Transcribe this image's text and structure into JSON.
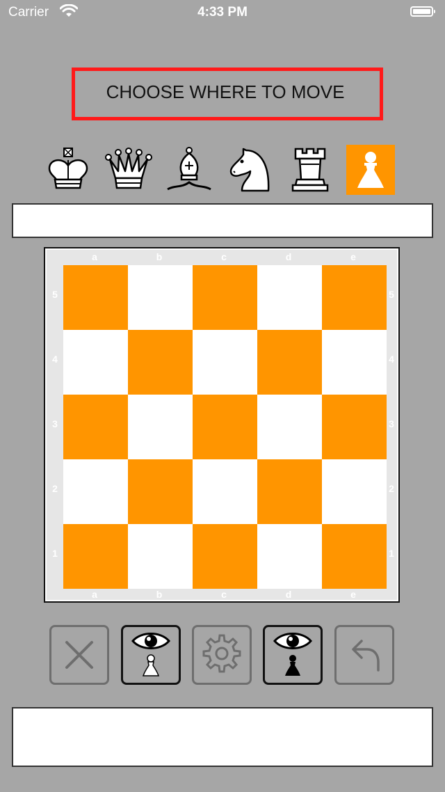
{
  "status_bar": {
    "carrier": "Carrier",
    "time": "4:33 PM"
  },
  "prompt": {
    "text": "CHOOSE WHERE TO MOVE",
    "border_color": "#ff1a1a"
  },
  "piece_selector": {
    "pieces": [
      "king",
      "queen",
      "bishop",
      "knight",
      "rook",
      "pawn"
    ],
    "selected": "pawn",
    "accent_color": "#ff9500"
  },
  "board": {
    "files": [
      "a",
      "b",
      "c",
      "d",
      "e"
    ],
    "ranks": [
      "5",
      "4",
      "3",
      "2",
      "1"
    ],
    "dark_color": "#ff9500",
    "light_color": "#ffffff"
  },
  "controls": [
    {
      "name": "close",
      "icon": "close-icon",
      "enabled": false
    },
    {
      "name": "view-white",
      "icon": "eye-white-pawn-icon",
      "enabled": true
    },
    {
      "name": "settings",
      "icon": "gear-icon",
      "enabled": false
    },
    {
      "name": "view-black",
      "icon": "eye-black-pawn-icon",
      "enabled": true
    },
    {
      "name": "undo",
      "icon": "undo-arrow-icon",
      "enabled": false
    }
  ],
  "top_field": {
    "value": ""
  },
  "bottom_field": {
    "value": ""
  }
}
